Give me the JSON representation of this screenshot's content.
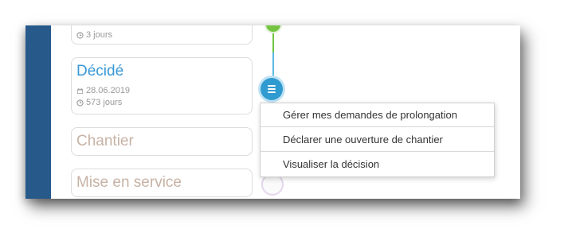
{
  "timeline": {
    "previous_step": {
      "duration": "3 jours"
    },
    "decided_step": {
      "title": "Décidé",
      "date": "28.06.2019",
      "duration": "573 jours"
    },
    "chantier_step": {
      "title": "Chantier"
    },
    "service_step": {
      "title": "Mise en service"
    }
  },
  "context_menu": {
    "items": [
      {
        "label": "Gérer mes demandes de prolongation"
      },
      {
        "label": "Déclarer une ouverture de chantier"
      },
      {
        "label": "Visualiser la décision"
      }
    ]
  },
  "colors": {
    "sidebar": "#275a8b",
    "accent": "#3a98d6",
    "timeline_green": "#74c442",
    "timeline_blue": "#5bbbe3"
  },
  "icons": [
    "clock-icon",
    "calendar-icon",
    "menu-icon"
  ]
}
